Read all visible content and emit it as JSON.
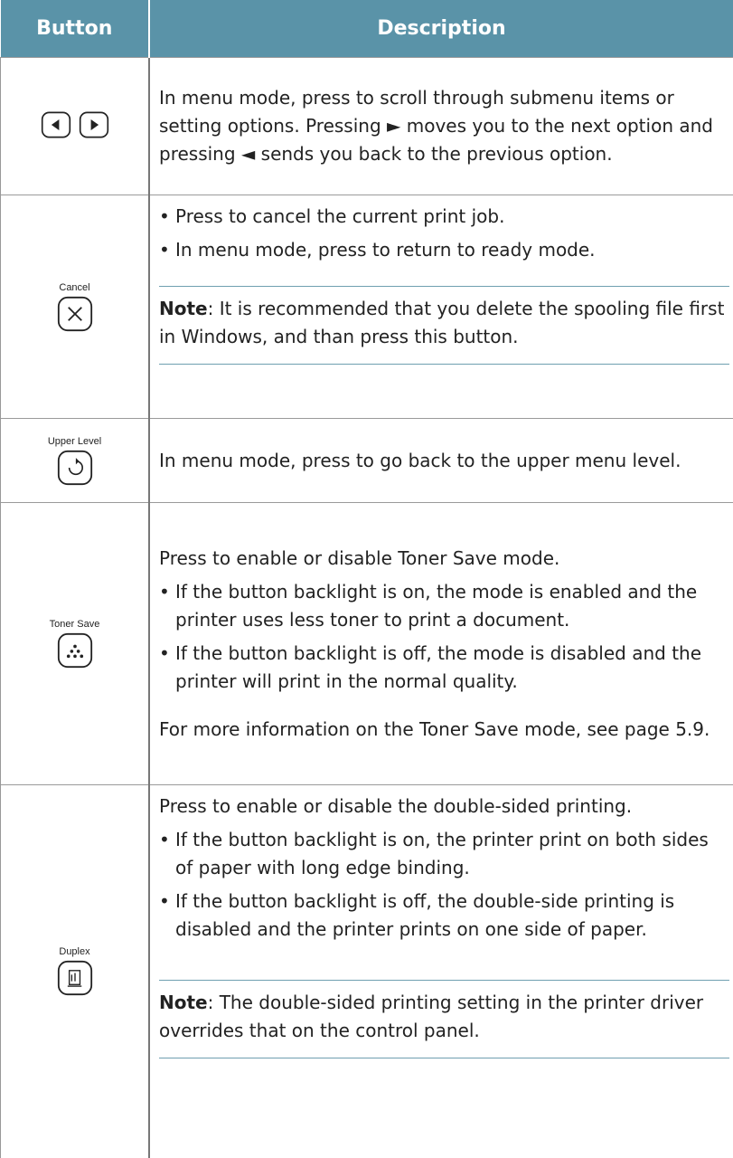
{
  "header": {
    "col_button": "Button",
    "col_description": "Description"
  },
  "rows": {
    "scroll": {
      "icon_left": "left-arrow-key-icon",
      "icon_right": "right-arrow-key-icon",
      "text": "In menu mode, press to scroll through submenu items or setting options. Pressing ► moves you to the next option and pressing ◄ sends you back to the previous option."
    },
    "cancel": {
      "caption": "Cancel",
      "icon": "cancel-x-key-icon",
      "bullets": [
        "Press to cancel the current print job.",
        "In menu mode, press to return to ready mode."
      ],
      "note_label": "Note",
      "note_text": ": It is recommended that you delete the spooling file first in Windows, and than press this button."
    },
    "upper": {
      "caption": "Upper Level",
      "icon": "upper-level-return-key-icon",
      "text": "In menu mode, press to go back to the upper menu level."
    },
    "toner": {
      "caption": "Toner Save",
      "icon": "toner-save-dots-key-icon",
      "intro": "Press to enable or disable Toner Save mode.",
      "bullets": [
        "If the button backlight is on, the mode is enabled and the printer uses less toner to print a document.",
        "If the button backlight is off, the mode is disabled and the printer will print in the normal quality."
      ],
      "more": "For more information on the Toner Save mode, see page 5.9."
    },
    "duplex": {
      "caption": "Duplex",
      "icon": "duplex-page-key-icon",
      "intro": "Press to enable or disable the double-sided printing.",
      "bullets": [
        "If the button backlight is on, the printer print on both sides of paper with long edge binding.",
        "If the button backlight is off, the double-side printing is disabled and the printer prints on one side of paper."
      ],
      "note_label": "Note",
      "note_text": ": The double-sided printing setting in the printer driver overrides that on the control panel."
    }
  },
  "bullet_char": "•",
  "colors": {
    "header_bg": "#5a93a8",
    "note_rule": "#6f9fb0"
  }
}
